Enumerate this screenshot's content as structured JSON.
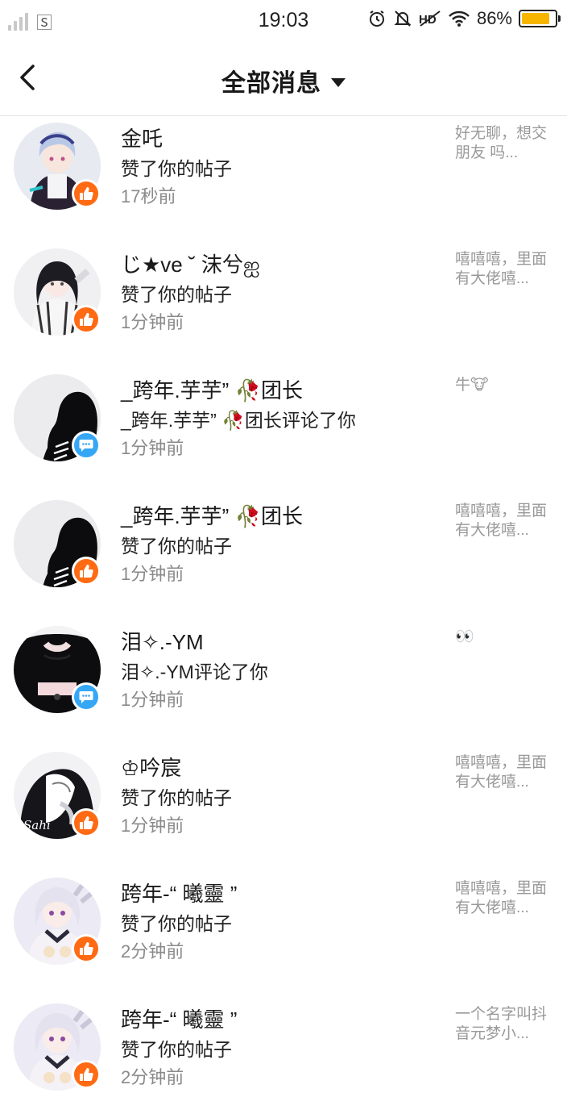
{
  "status_bar": {
    "carrier_glyph": "🅂",
    "time": "19:03",
    "battery_percent": "86%",
    "battery_level": 0.86,
    "icons": [
      "alarm-icon",
      "bell-off-icon",
      "nfc-icon",
      "wifi-icon",
      "battery-icon"
    ]
  },
  "nav": {
    "back_icon": "chevron-left-icon",
    "title": "全部消息",
    "dropdown_icon": "caret-down-icon"
  },
  "colors": {
    "like_badge": "#ff6a13",
    "comment_badge": "#36a7f5",
    "time_text": "#8a8a8a",
    "preview_text": "#999999",
    "battery_fill": "#f7b500"
  },
  "messages": [
    {
      "name": "金吒",
      "action": "赞了你的帖子",
      "time": "17秒前",
      "preview": "好无聊，想交朋友 吗...",
      "badge": "like",
      "avatar": "light-hair"
    },
    {
      "name": "じ★ve ˘ 沫兮ஐ",
      "action": "赞了你的帖子",
      "time": "1分钟前",
      "preview": "嘻嘻嘻，里面有大佬嘻...",
      "badge": "like",
      "avatar": "dark-hair"
    },
    {
      "name": "_跨年.芋芋” 🥀团长",
      "action": "_跨年.芋芋” 🥀团长评论了你",
      "time": "1分钟前",
      "preview": "牛🐮",
      "badge": "comment",
      "avatar": "silhouette"
    },
    {
      "name": "_跨年.芋芋” 🥀团长",
      "action": "赞了你的帖子",
      "time": "1分钟前",
      "preview": "嘻嘻嘻，里面有大佬嘻...",
      "badge": "like",
      "avatar": "silhouette"
    },
    {
      "name": "泪✧.-YM",
      "action": "泪✧.-YM评论了你",
      "time": "1分钟前",
      "preview": "👀",
      "badge": "comment",
      "avatar": "dark-body"
    },
    {
      "name": "♔吟宸",
      "action": "赞了你的帖子",
      "time": "1分钟前",
      "preview": "嘻嘻嘻，里面有大佬嘻...",
      "badge": "like",
      "avatar": "hooded"
    },
    {
      "name": "跨年-“ 曦靈 ”",
      "action": "赞了你的帖子",
      "time": "2分钟前",
      "preview": "嘻嘻嘻，里面有大佬嘻...",
      "badge": "like",
      "avatar": "white-hair"
    },
    {
      "name": "跨年-“ 曦靈 ”",
      "action": "赞了你的帖子",
      "time": "2分钟前",
      "preview": "一个名字叫抖音元梦小...",
      "badge": "like",
      "avatar": "white-hair"
    }
  ]
}
